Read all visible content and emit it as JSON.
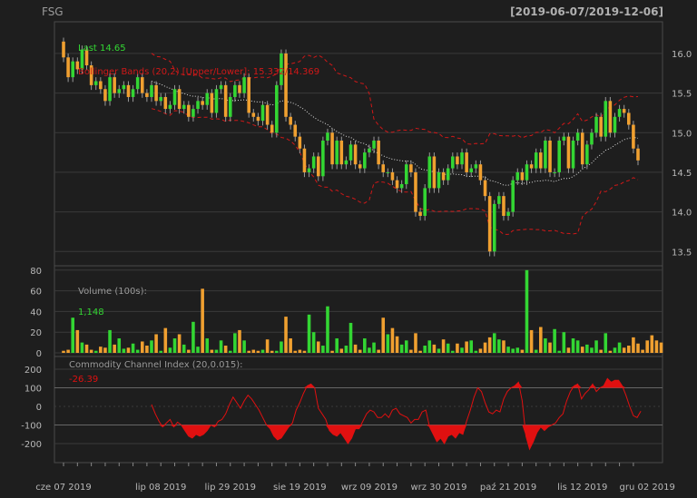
{
  "header": {
    "ticker": "FSG",
    "period": "[2019-06-07/2019-12-06]"
  },
  "colors": {
    "background": "#1e1e1e",
    "up": "#33d633",
    "down": "#f0a030",
    "band": "#d01818",
    "cci": "#e01010",
    "grid": "#3a3a3a",
    "text": "#b8b8b8"
  },
  "chart_data": [
    {
      "type": "candlestick",
      "annotations": {
        "last": "Last 14.65",
        "bbands": "Bollinger Bands (20,2) [Upper/Lower]: 15.332/14.369"
      },
      "y_ticks": [
        "16.0",
        "15.5",
        "15.0",
        "14.5",
        "14.0",
        "13.5"
      ],
      "y_tick_values": [
        16.0,
        15.5,
        15.0,
        14.5,
        14.0,
        13.5
      ],
      "ylim": [
        13.4,
        16.4
      ],
      "x_ticks": [
        "cze 07 2019",
        "lip 08 2019",
        "lip 29 2019",
        "sie 19 2019",
        "wrz 09 2019",
        "wrz 30 2019",
        "paź 21 2019",
        "lis 12 2019",
        "gru 02 2019"
      ],
      "x_tick_index": [
        0,
        21,
        36,
        51,
        66,
        81,
        96,
        112,
        126
      ],
      "closes": [
        15.95,
        15.7,
        15.9,
        15.8,
        16.05,
        15.85,
        15.6,
        15.65,
        15.55,
        15.4,
        15.7,
        15.5,
        15.55,
        15.6,
        15.45,
        15.55,
        15.7,
        15.5,
        15.45,
        15.6,
        15.4,
        15.45,
        15.3,
        15.35,
        15.55,
        15.3,
        15.35,
        15.2,
        15.3,
        15.4,
        15.35,
        15.5,
        15.25,
        15.55,
        15.6,
        15.2,
        15.45,
        15.6,
        15.5,
        15.7,
        15.25,
        15.2,
        15.15,
        15.35,
        15.1,
        15.0,
        15.6,
        16.0,
        15.2,
        15.1,
        14.95,
        14.8,
        14.5,
        14.55,
        14.7,
        14.45,
        14.9,
        15.0,
        14.6,
        14.9,
        14.6,
        14.65,
        14.85,
        14.6,
        14.55,
        14.75,
        14.8,
        14.9,
        14.6,
        14.5,
        14.5,
        14.4,
        14.3,
        14.35,
        14.6,
        14.5,
        14.0,
        13.95,
        14.3,
        14.7,
        14.3,
        14.5,
        14.4,
        14.55,
        14.7,
        14.6,
        14.75,
        14.5,
        14.55,
        14.6,
        14.4,
        14.2,
        13.5,
        14.1,
        14.2,
        13.95,
        14.0,
        14.4,
        14.5,
        14.4,
        14.6,
        14.55,
        14.75,
        14.55,
        14.9,
        14.5,
        14.5,
        14.9,
        14.95,
        14.55,
        14.9,
        15.0,
        14.6,
        14.85,
        15.0,
        15.2,
        14.95,
        15.4,
        15.0,
        15.2,
        15.3,
        15.25,
        15.1,
        14.8,
        14.65
      ],
      "volume_ticks": [
        "80",
        "60",
        "40",
        "20",
        "0"
      ],
      "volume_tick_values": [
        80,
        60,
        40,
        20,
        0
      ],
      "volume_label": "Volume (100s):",
      "volume_last": "1,148",
      "volumes": [
        2,
        3,
        34,
        22,
        10,
        8,
        3,
        2,
        6,
        5,
        22,
        8,
        14,
        4,
        5,
        9,
        3,
        11,
        7,
        12,
        18,
        2,
        24,
        5,
        14,
        18,
        8,
        3,
        30,
        6,
        62,
        14,
        3,
        3,
        12,
        7,
        2,
        19,
        22,
        12,
        2,
        3,
        2,
        3,
        13,
        2,
        2,
        11,
        35,
        14,
        2,
        3,
        2,
        37,
        20,
        11,
        7,
        45,
        2,
        14,
        4,
        7,
        29,
        8,
        3,
        14,
        5,
        10,
        3,
        34,
        18,
        24,
        16,
        8,
        12,
        3,
        19,
        2,
        7,
        12,
        8,
        4,
        13,
        9,
        2,
        9,
        5,
        11,
        12,
        2,
        4,
        10,
        15,
        19,
        13,
        12,
        6,
        4,
        5,
        3,
        80,
        22,
        3,
        25,
        14,
        10,
        23,
        2,
        20,
        5,
        14,
        12,
        6,
        8,
        5,
        12,
        3,
        19,
        2,
        5,
        10,
        5,
        7,
        15,
        9,
        3,
        12,
        17,
        12,
        10
      ]
    },
    {
      "type": "line",
      "title": "Commodity Channel Index (20,0.015):",
      "last": "-26.39",
      "y_ticks": [
        "200",
        "100",
        "0",
        "-100",
        "-200"
      ],
      "y_tick_values": [
        200,
        100,
        0,
        -100,
        -200
      ],
      "ylim": [
        -250,
        250
      ],
      "start_index": 19,
      "values": [
        10,
        -40,
        -80,
        -110,
        -90,
        -70,
        -110,
        -85,
        -100,
        -130,
        -160,
        -170,
        -150,
        -160,
        -150,
        -130,
        -100,
        -110,
        -80,
        -70,
        -40,
        10,
        50,
        20,
        -10,
        30,
        60,
        40,
        10,
        -20,
        -60,
        -100,
        -120,
        -160,
        -180,
        -170,
        -140,
        -110,
        -90,
        -20,
        20,
        70,
        110,
        120,
        100,
        -10,
        -40,
        -70,
        -130,
        -150,
        -160,
        -140,
        -170,
        -200,
        -170,
        -120,
        -120,
        -80,
        -40,
        -20,
        -30,
        -60,
        -60,
        -40,
        -60,
        -20,
        -10,
        -40,
        -50,
        -60,
        -90,
        -70,
        -70,
        -30,
        -20,
        -110,
        -150,
        -190,
        -170,
        -200,
        -160,
        -150,
        -170,
        -140,
        -150,
        -80,
        -20,
        50,
        100,
        80,
        20,
        -30,
        -40,
        -20,
        -30,
        40,
        80,
        100,
        110,
        130,
        30,
        -160,
        -230,
        -190,
        -140,
        -110,
        -130,
        -110,
        -100,
        -90,
        -60,
        -40,
        30,
        80,
        110,
        120,
        40,
        70,
        90,
        120,
        80,
        100,
        110,
        150,
        130,
        140,
        140,
        110,
        60,
        0,
        -50,
        -60,
        -26
      ]
    }
  ]
}
